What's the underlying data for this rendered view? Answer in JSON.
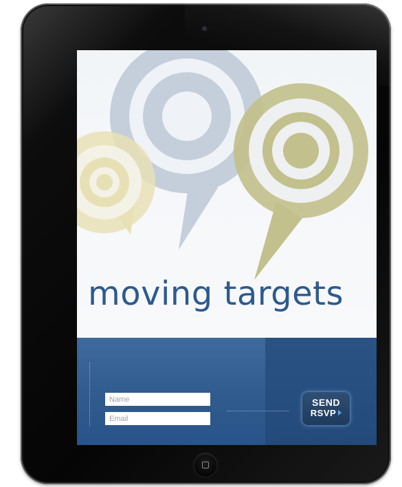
{
  "app": {
    "title": "moving targets"
  },
  "form": {
    "name_placeholder": "Name",
    "name_value": "",
    "email_placeholder": "Email",
    "email_value": "",
    "send_label_line1": "SEND",
    "send_label_line2": "RSVP"
  },
  "icons": {
    "home": "home-button-icon",
    "camera": "camera-icon",
    "send_arrow": "triangle-right-icon",
    "graphics": [
      "target-pin-blue",
      "target-pin-olive",
      "target-pin-yellow"
    ]
  },
  "colors": {
    "title": "#2c5a8e",
    "panel": "#2f5b8e",
    "target_blue": "#c4cfdb",
    "target_olive": "#c2c08c",
    "target_yellow": "#e7e0b5",
    "button_glow": "#78aae6"
  }
}
